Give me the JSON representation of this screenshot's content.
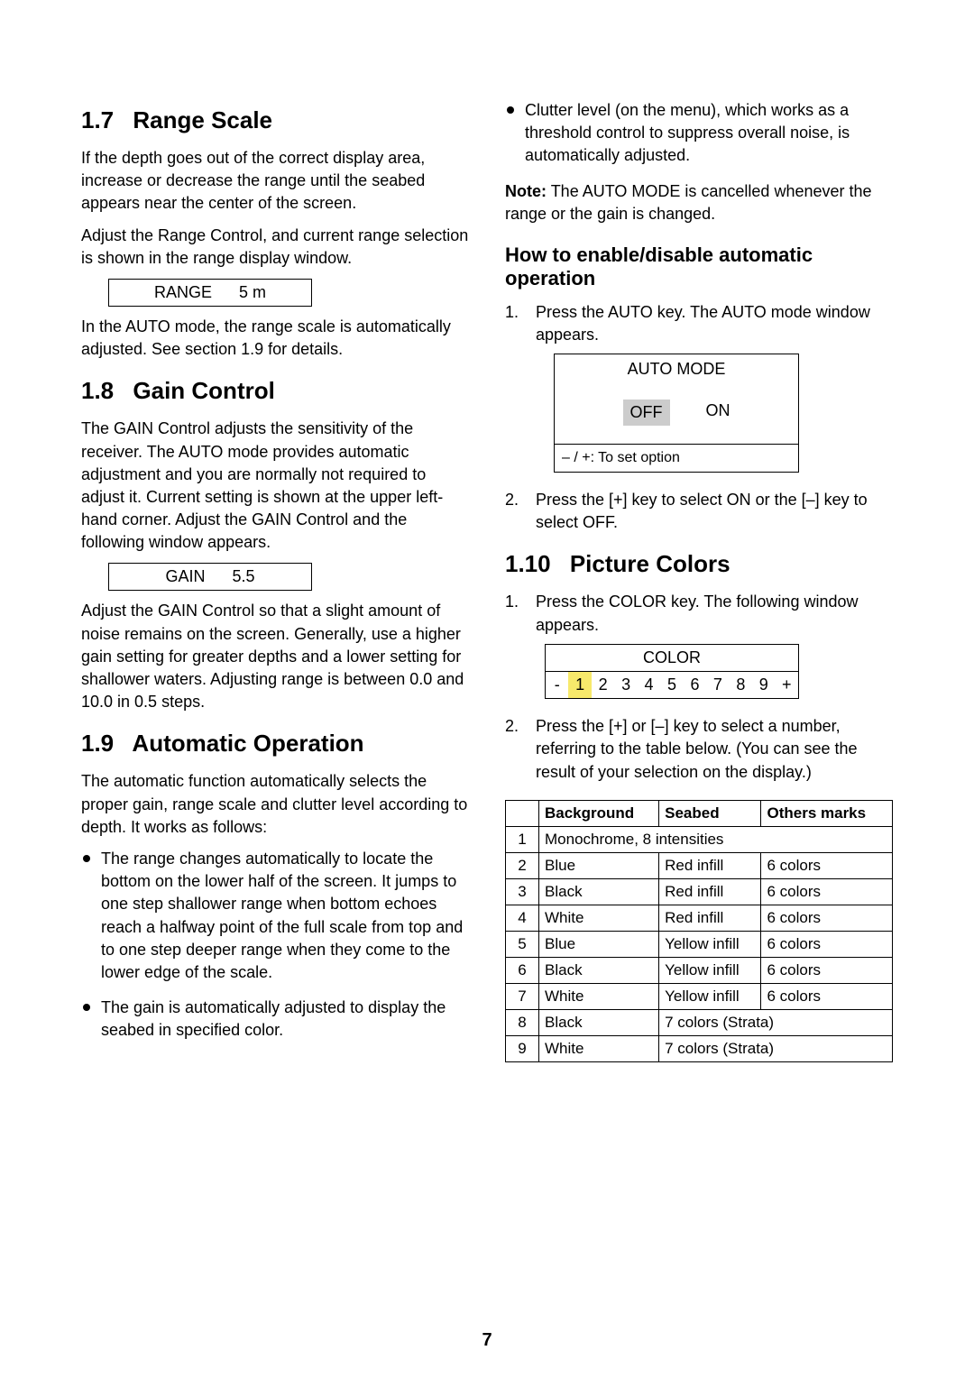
{
  "page_number": "7",
  "left": {
    "s17": {
      "num": "1.7",
      "title": "Range Scale",
      "p1": "If the depth goes out of the correct display area, increase or decrease the range until the seabed appears near the center of the screen.",
      "p2": "Adjust the Range Control, and current range selection is shown in the range display window.",
      "box_label": "RANGE",
      "box_value": "5 m",
      "p3": "In the AUTO mode, the range scale is automatically adjusted. See section 1.9 for details."
    },
    "s18": {
      "num": "1.8",
      "title": "Gain Control",
      "p1": "The GAIN Control adjusts the sensitivity of the receiver. The AUTO mode provides automatic adjustment and you are normally not required to adjust it. Current setting is shown at the upper left-hand corner. Adjust the GAIN Control and the following window appears.",
      "box_label": "GAIN",
      "box_value": "5.5",
      "p2": "Adjust the GAIN Control so that a slight amount of noise remains on the screen. Generally, use a higher gain setting for greater depths and a lower setting for shallower waters. Adjusting range is between 0.0 and 10.0 in 0.5 steps."
    },
    "s19": {
      "num": "1.9",
      "title": "Automatic Operation",
      "p1": "The automatic function automatically selects the proper gain, range scale and clutter level according to depth. It works as follows:",
      "b1": "The range changes automatically to locate the bottom on the lower half of the screen. It jumps to one step shallower range when bottom echoes reach a halfway point of the full scale from top and to one step deeper range when they come to the lower edge of the scale.",
      "b2": "The gain is automatically adjusted to display the seabed in specified color."
    }
  },
  "right": {
    "b3": "Clutter level (on the menu), which works as a threshold control to suppress overall noise, is automatically adjusted.",
    "note_label": "Note:",
    "note_text": "The AUTO MODE is cancelled whenever the range or the gain is changed.",
    "howto_title": "How to enable/disable automatic operation",
    "step1": "Press the AUTO key. The AUTO mode window appears.",
    "auto_mode": {
      "title": "AUTO MODE",
      "off": "OFF",
      "on": "ON",
      "hint": "– / +:   To set option"
    },
    "step2": "Press the [+] key to select ON or the [–] key to select OFF.",
    "s110": {
      "num": "1.10",
      "title": "Picture Colors",
      "step1": "Press the COLOR key. The following window appears.",
      "color_title": "COLOR",
      "color_cells": [
        "-",
        "1",
        "2",
        "3",
        "4",
        "5",
        "6",
        "7",
        "8",
        "9",
        "+"
      ],
      "selected_index": 1,
      "step2": "Press the [+] or [–] key to select a number, referring to the table below. (You can see the result of your selection on the display.)"
    },
    "table": {
      "h_blank": "",
      "h_bg": "Background",
      "h_seabed": "Seabed",
      "h_others": "Others marks",
      "rows": [
        {
          "n": "1",
          "span": "Monochrome, 8 intensities"
        },
        {
          "n": "2",
          "bg": "Blue",
          "sb": "Red infill",
          "om": "6 colors"
        },
        {
          "n": "3",
          "bg": "Black",
          "sb": "Red infill",
          "om": "6 colors"
        },
        {
          "n": "4",
          "bg": "White",
          "sb": "Red infill",
          "om": "6 colors"
        },
        {
          "n": "5",
          "bg": "Blue",
          "sb": "Yellow infill",
          "om": "6 colors"
        },
        {
          "n": "6",
          "bg": "Black",
          "sb": "Yellow infill",
          "om": "6 colors"
        },
        {
          "n": "7",
          "bg": "White",
          "sb": "Yellow infill",
          "om": "6 colors"
        },
        {
          "n": "8",
          "bg": "Black",
          "span2": "7 colors (Strata)"
        },
        {
          "n": "9",
          "bg": "White",
          "span2": "7 colors (Strata)"
        }
      ]
    }
  }
}
